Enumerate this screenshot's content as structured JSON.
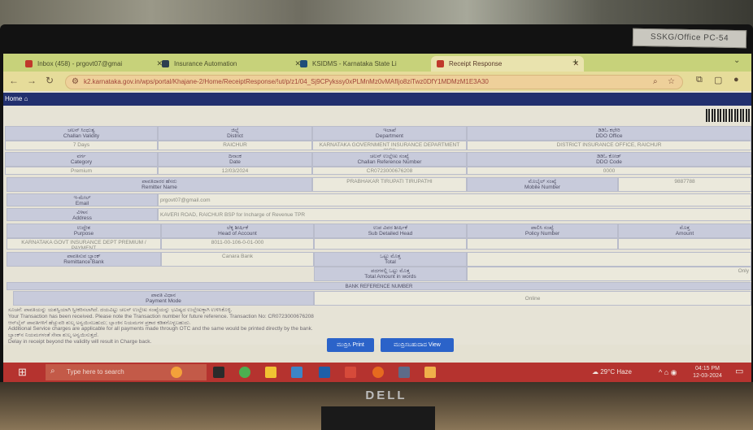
{
  "physical": {
    "sticker_text": "SSKG/Office PC-54",
    "monitor_brand": "DELL"
  },
  "browser": {
    "tabs": [
      {
        "label": "Inbox (458) - prgovt07@gmai",
        "icon_color": "#c0392b"
      },
      {
        "label": "Insurance Automation",
        "icon_color": "#2c3e50"
      },
      {
        "label": "KSIDMS - Karnataka State Li",
        "icon_color": "#1f4e79"
      },
      {
        "label": "Receipt Response",
        "icon_color": "#c0392b",
        "active": true
      }
    ],
    "new_tab": "+",
    "url": "k2.karnataka.gov.in/wps/portal/Khajane-2/Home/ReceiptResponse/!ut/p/z1/04_Sj9CPykssy0xPLMnMz0vMAfIjo8ziTwz0DfY1MDMzM1E3A30"
  },
  "page": {
    "home_label": "Home",
    "row1": {
      "challan_validity_label": "ಚಲನ್ ಸಿಂಧುತ್ವ\nChallan Validity",
      "district_label": "ಜಿಲ್ಲೆ\nDistrict",
      "department_label": "ಇಲಾಖೆ\nDepartment",
      "ddo_office_label": "ಡಿಡಿಓ ಕಛೇರಿ\nDDO Office"
    },
    "row1_values": {
      "challan_validity": "7 Days",
      "district": "RAICHUR",
      "department": "KARNATAKA GOVERNMENT INSURANCE DEPARTMENT (KGI)",
      "ddo_office": "DISTRICT INSURANCE OFFICE, RAICHUR"
    },
    "row2": {
      "category_label": "ವರ್ಗ\nCategory",
      "date_label": "ದಿನಾಂಕ\nDate",
      "challan_ref_label": "ಚಲನ್ ಉಲ್ಲೇಖ ಸಂಖ್ಯೆ\nChallan Reference Number",
      "ddo_code_label": "ಡಿಡಿಓ ಕೋಡ್\nDDO Code"
    },
    "row2_values": {
      "category": "Premium",
      "date": "12/03/2024",
      "challan_ref": "CR0723000676208",
      "ddo_code": "0000"
    },
    "remitter_name_label": "ಪಾವತಿದಾರರ ಹೆಸರು\nRemitter Name",
    "remitter_name": "PRABHAKAR TIRUPATI TIRUPATHI",
    "mobile_label": "ಮೊಬೈಲ್ ಸಂಖ್ಯೆ\nMobile Number",
    "mobile": "9887788",
    "email_label": "ಇ-ಮೇಲ್\nEmail",
    "email": "prgovt07@gmail.com",
    "address_label": "ವಿಳಾಸ\nAddress",
    "address": "KAVERI ROAD, RAICHUR BSP for Incharge of Revenue TPR",
    "table_headers": {
      "purpose": "ಉದ್ದೇಶ\nPurpose",
      "head_of_account": "ಲೆಕ್ಕ ಶೀರ್ಷಿಕೆ\nHead of Account",
      "sub_detailed_head": "ಉಪ ವಿವರ ಶೀರ್ಷಿಕೆ\nSub Detailed Head",
      "policy_number": "ಪಾಲಿಸಿ ಸಂಖ್ಯೆ\nPolicy Number",
      "amount": "ಮೊತ್ತ\nAmount"
    },
    "table_row": {
      "purpose": "KARNATAKA GOVT INSURANCE DEPT PREMIUM / PAYMENT",
      "head_of_account": "8011-00-106-0-01-000",
      "sub_detailed_head": "",
      "policy_number": "",
      "amount": ""
    },
    "remittance_bank_label": "ಪಾವತಿಸುವ ಬ್ಯಾಂಕ್\nRemittance Bank",
    "remittance_bank": "Canara Bank",
    "total_label": "ಒಟ್ಟು ಮೊತ್ತ\nTotal",
    "total_words_label": "ಪದಗಳಲ್ಲಿ ಒಟ್ಟು ಮೊತ್ತ\nTotal Amount in words",
    "total_words": "Only",
    "payment_mode_header": "ಪಾವತಿ ವಿಧಾನ\nPayment Mode",
    "payment_mode": "Online",
    "bank_reference_label": "BANK REFERENCE NUMBER",
    "notes": [
      "ಸೂಚನೆ: ಪಾವತಿಯನ್ನು ಯಶಸ್ವಿಯಾಗಿ ಸ್ವೀಕರಿಸಲಾಗಿದೆ. ದಯವಿಟ್ಟು ಚಲನ್ ಉಲ್ಲೇಖ ಸಂಖ್ಯೆಯನ್ನು ಭವಿಷ್ಯದ ಉಲ್ಲೇಖಕ್ಕಾಗಿ ಉಳಿಸಿಕೊಳ್ಳಿ.",
      "Your Transaction has been received. Please note the Transaction number for future reference. Transaction No: CR0723000676208",
      "ಆನ್‌ಲೈನ್ ಪಾವತಿಗಳಿಗೆ ಹೆಚ್ಚುವರಿ ಶುಲ್ಕ ಅನ್ವಯಿಸಬಹುದು; ಬ್ಯಾಂಕಿನ ನಿಯಮಗಳ ಪ್ರಕಾರ ಕಡಿತಗೊಳ್ಳಬಹುದು.",
      "Additional Service charges are applicable for all payments made through OTC and the same would be printed directly by the bank.",
      "ಬ್ಯಾಂಕ್‌ನ ನಿಯಮಗಳಂತೆ ಸೇವಾ ಶುಲ್ಕ ಅನ್ವಯಿಸುತ್ತದೆ.",
      "Delay in receipt beyond the validity will result in Charge back."
    ],
    "buttons": {
      "pdf": "ಮುದ್ರಿಸಿ Print",
      "view": "ಮುದ್ರಿಸಬಹುದಾದ View"
    }
  },
  "taskbar": {
    "search_placeholder": "Type here to search",
    "weather": "29°C Haze",
    "time": "04:15 PM",
    "date": "12-03-2024"
  }
}
